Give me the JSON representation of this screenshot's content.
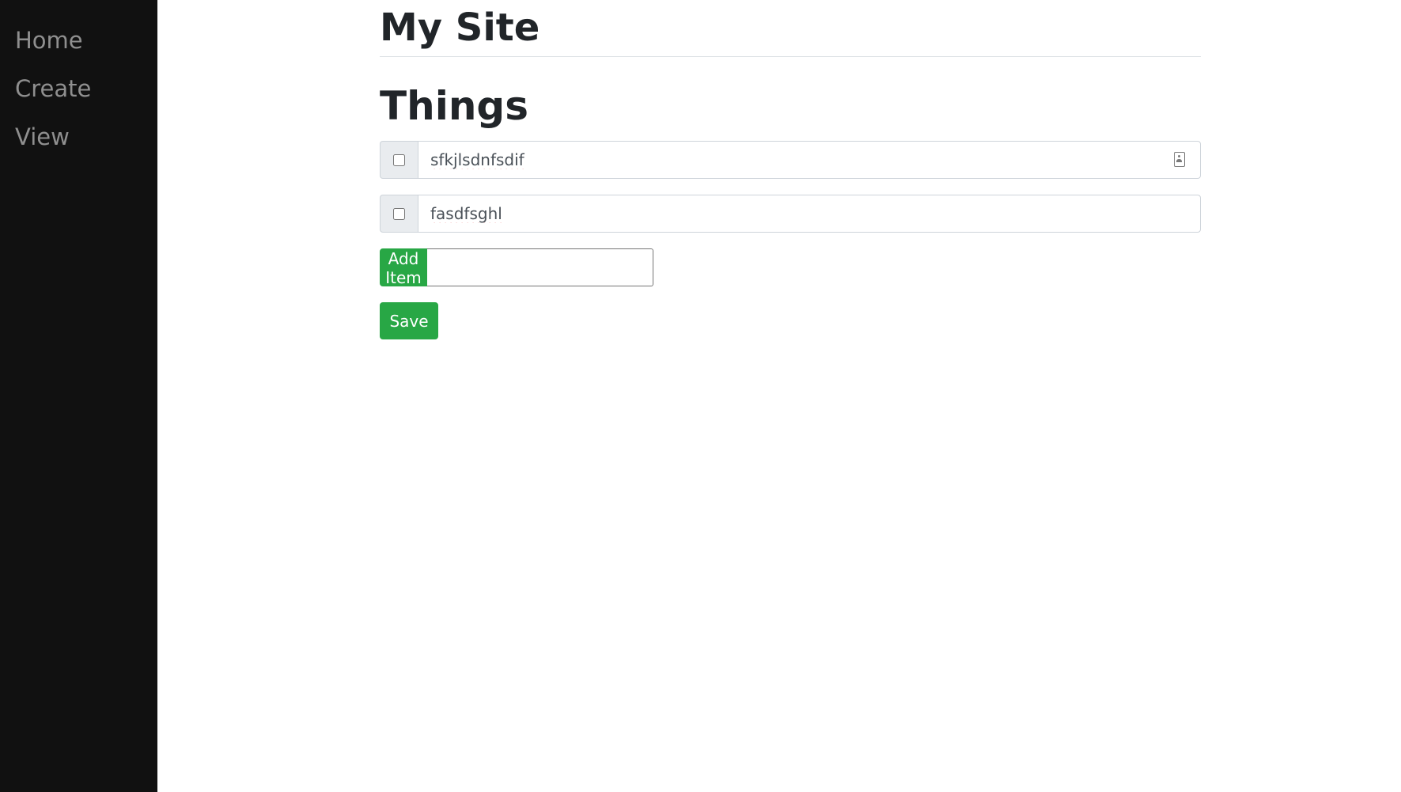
{
  "sidebar": {
    "items": [
      {
        "label": "Home"
      },
      {
        "label": "Create"
      },
      {
        "label": "View"
      }
    ]
  },
  "header": {
    "title": "My Site"
  },
  "main": {
    "section_title": "Things",
    "items": [
      {
        "value": "sfkjlsdnfsdif",
        "checked": false
      },
      {
        "value": "fasdfsghl",
        "checked": false
      }
    ],
    "add_button_label": "Add Item",
    "add_input_value": "",
    "save_label": "Save"
  },
  "colors": {
    "sidebar_bg": "#111111",
    "sidebar_text": "#8f8f8f",
    "button_green": "#28a745"
  },
  "icons": {
    "autofill": "contact-card-icon"
  }
}
